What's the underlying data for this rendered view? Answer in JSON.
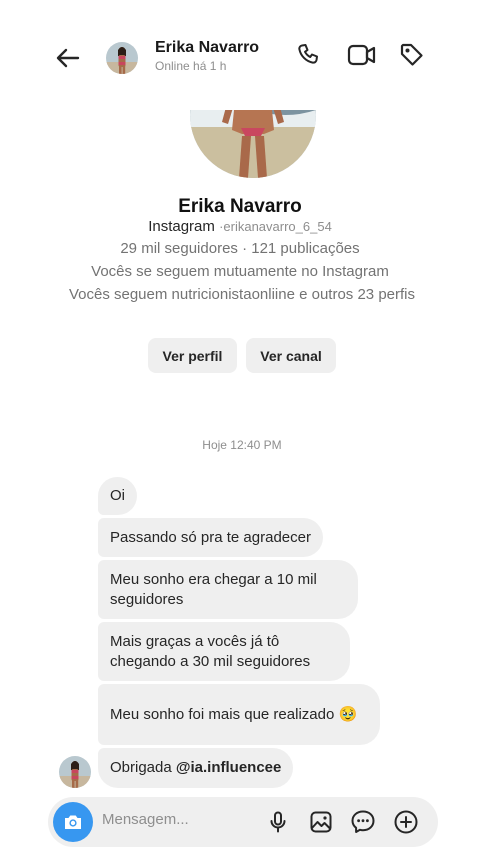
{
  "header": {
    "name": "Erika Navarro",
    "status": "Online há 1 h"
  },
  "profile": {
    "name": "Erika Navarro",
    "source": "Instagram",
    "handle": "·erikanavarro_6_54",
    "stats": "29 mil seguidores · 121 publicações",
    "mutual": "Vocês se seguem mutuamente no Instagram",
    "follows": "Vocês seguem nutricionistaonliine e outros 23 perfis",
    "view_profile_label": "Ver perfil",
    "view_channel_label": "Ver canal"
  },
  "conversation": {
    "timestamp": "Hoje 12:40 PM",
    "messages": [
      {
        "text": "Oi"
      },
      {
        "text": "Passando só pra te agradecer"
      },
      {
        "text": "Meu sonho era chegar a 10 mil seguidores"
      },
      {
        "text": "Mais graças a vocês já tô chegando a 30 mil seguidores"
      },
      {
        "text": "Meu sonho foi mais que realizado 🥹"
      },
      {
        "prefix": "Obrigada ",
        "mention": "@ia.influencee"
      }
    ]
  },
  "composer": {
    "placeholder": "Mensagem..."
  },
  "colors": {
    "accent": "#3797f0",
    "bubble": "#efefef",
    "secondary_text": "#8e8e8e"
  }
}
